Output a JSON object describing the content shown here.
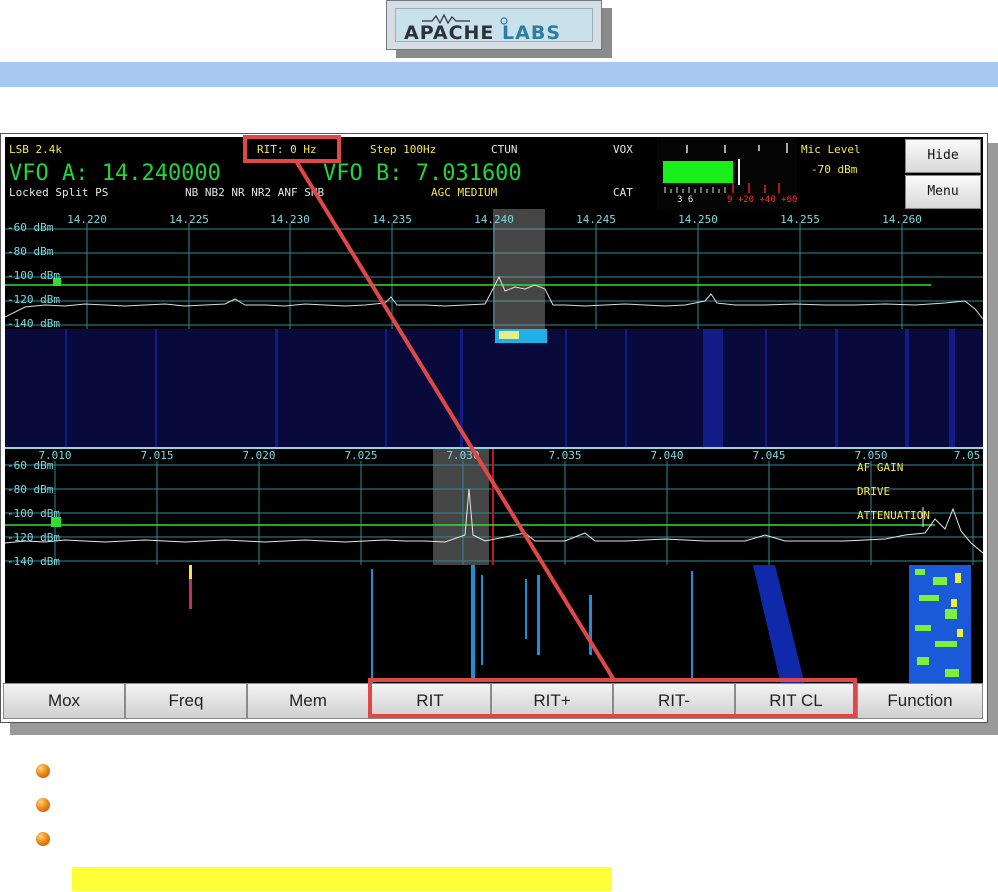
{
  "logo": {
    "part1": "APACHE",
    "part2": "LABS"
  },
  "status": {
    "mode": "LSB 2.4k",
    "rit": "RIT: 0 Hz",
    "step": "Step 100Hz",
    "ctun": "CTUN",
    "vox": "VOX",
    "mic_level_label": "Mic Level",
    "mic_level_value": "-70 dBm",
    "vfo_a": "VFO A: 14.240000",
    "vfo_b": "VFO B: 7.031600",
    "flags_left": "Locked Split  PS",
    "flags_dsp": "NB  NB2 NR  NR2 ANF SNB",
    "agc": "AGC MEDIUM",
    "cat": "CAT",
    "meter_scale_white": "3  6",
    "meter_scale_red": "9 +20  +40  +60",
    "mic_level_fraction": 0.6
  },
  "side_buttons": {
    "hide": "Hide",
    "menu": "Menu"
  },
  "panadapter_a": {
    "freqs": [
      "14.220",
      "14.225",
      "14.230",
      "14.235",
      "14.240",
      "14.245",
      "14.250",
      "14.255",
      "14.260"
    ],
    "dbm": [
      "-60 dBm",
      "-80 dBm",
      "-100 dBm",
      "-120 dBm",
      "-140 dBm"
    ]
  },
  "panadapter_b": {
    "freqs": [
      "7.010",
      "7.015",
      "7.020",
      "7.025",
      "7.030",
      "7.035",
      "7.040",
      "7.045",
      "7.050",
      "7.05"
    ],
    "dbm": [
      "-60 dBm",
      "-80 dBm",
      "-100 dBm",
      "-120 dBm",
      "-140 dBm"
    ],
    "overlay": [
      "AF GAIN",
      "DRIVE",
      "ATTENUATION"
    ]
  },
  "buttons": [
    "Mox",
    "Freq",
    "Mem",
    "RIT",
    "RIT+",
    "RIT-",
    "RIT CL",
    "Function"
  ],
  "colors": {
    "accent_bar": "#a7c8f0",
    "callout": "#e04848",
    "highlight": "#ffff36",
    "vfo_green": "#23d23f",
    "label_yellow": "#f6e84a"
  }
}
